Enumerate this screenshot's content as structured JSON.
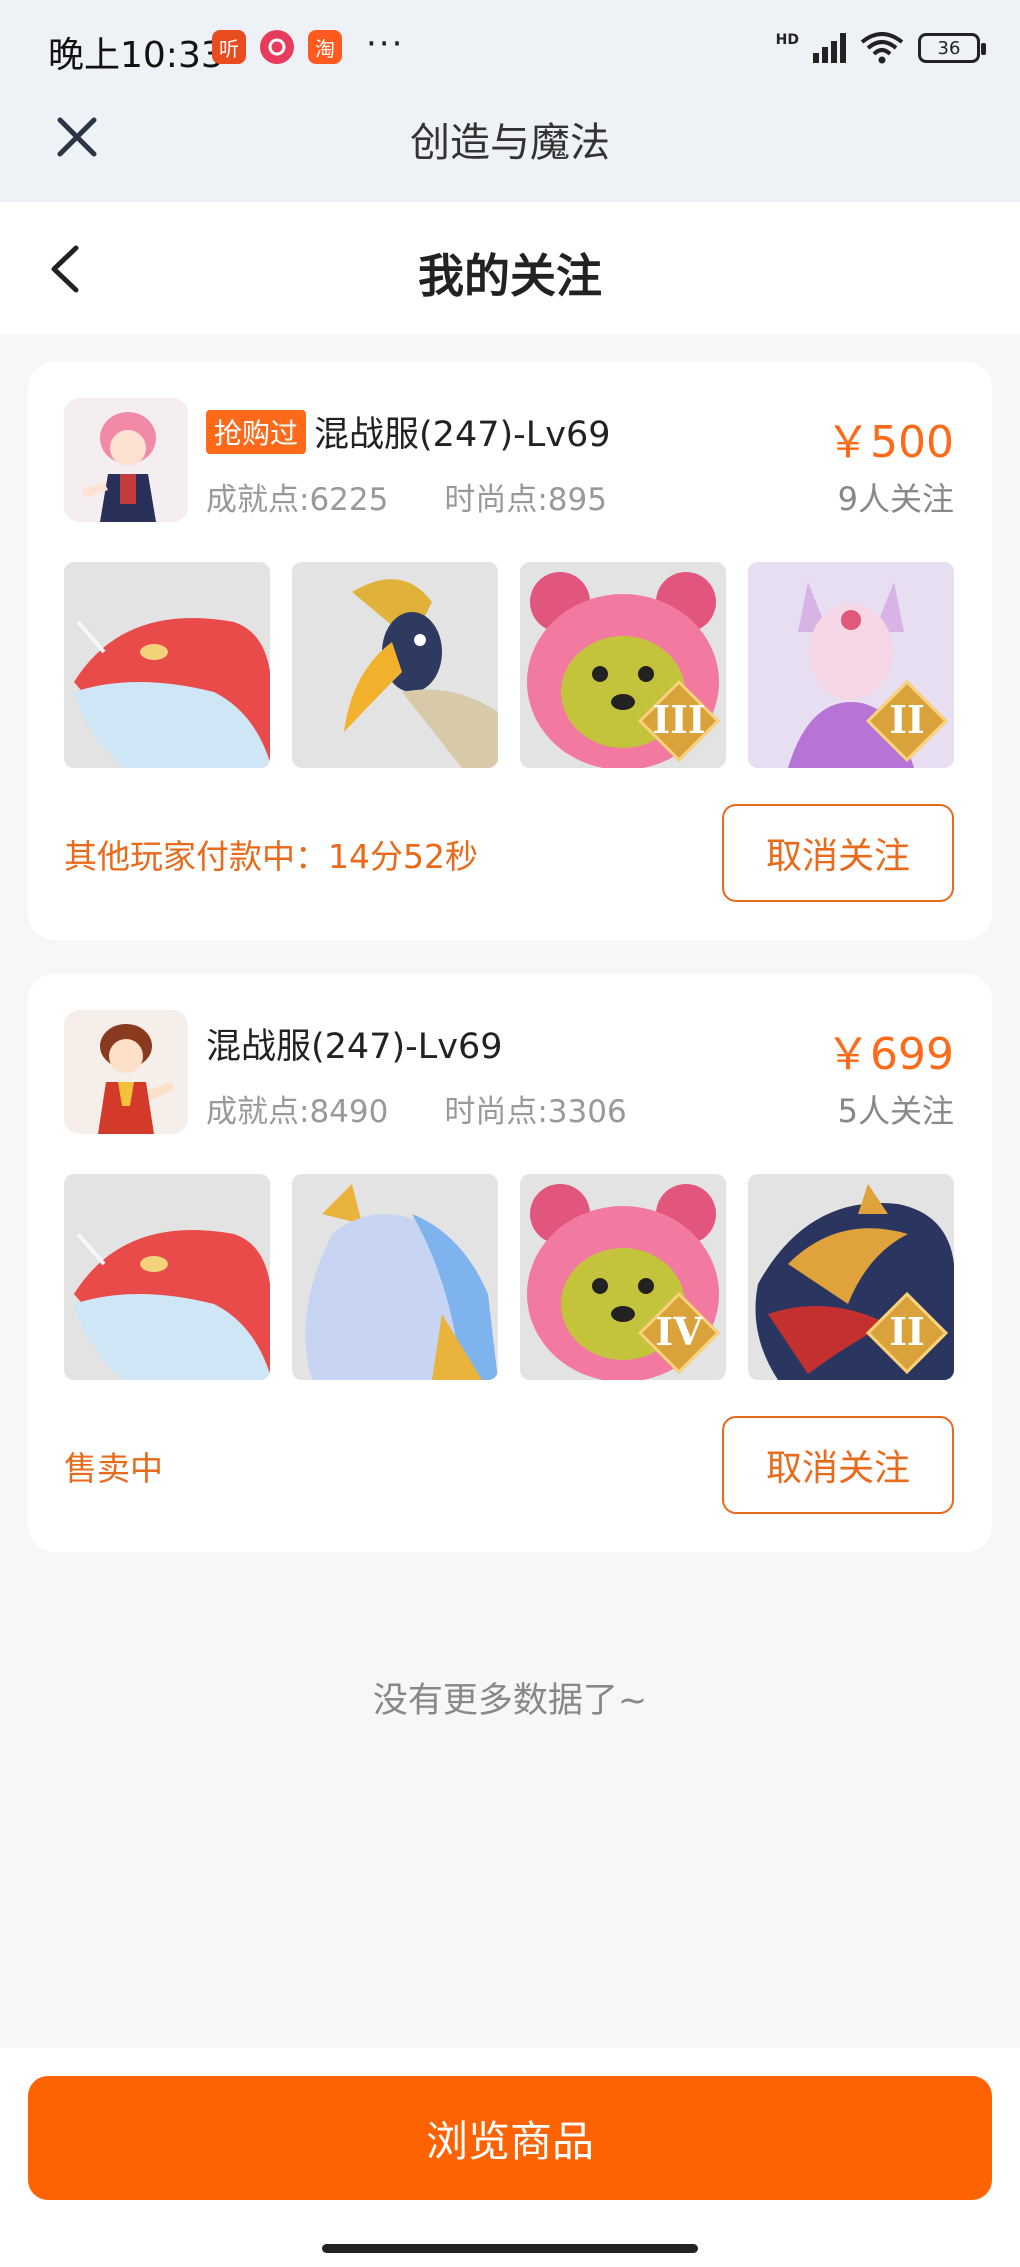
{
  "status_bar": {
    "time": "晚上10:33",
    "icons": [
      "ting-app-icon",
      "netease-music-icon",
      "taobao-icon"
    ],
    "app_ting": "听",
    "app_taobao": "淘",
    "more": "···",
    "network": "HD",
    "battery": "36"
  },
  "mini_header": {
    "title": "创造与魔法",
    "close_icon": "close-icon"
  },
  "page": {
    "title": "我的关注",
    "back_icon": "chevron-left-icon"
  },
  "listings": [
    {
      "badge": "抢购过",
      "title": "混战服(247)-Lv69",
      "achievement": "成就点:6225",
      "fashion": "时尚点:895",
      "price": "￥500",
      "followers": "9人关注",
      "thumbnails": [
        {
          "name": "dragon-fish-mount",
          "level": ""
        },
        {
          "name": "hornbill-mount",
          "level": ""
        },
        {
          "name": "pink-bear-pet",
          "level": "III"
        },
        {
          "name": "fox-spirit-pet",
          "level": "II"
        }
      ],
      "status": "其他玩家付款中：14分52秒",
      "action": "取消关注"
    },
    {
      "badge": "",
      "title": "混战服(247)-Lv69",
      "achievement": "成就点:8490",
      "fashion": "时尚点:3306",
      "price": "￥699",
      "followers": "5人关注",
      "thumbnails": [
        {
          "name": "dragon-fish-mount",
          "level": ""
        },
        {
          "name": "ice-horse-mount",
          "level": ""
        },
        {
          "name": "pink-bear-pet",
          "level": "IV"
        },
        {
          "name": "fire-dragon-mount",
          "level": "II"
        }
      ],
      "status": "售卖中",
      "action": "取消关注"
    }
  ],
  "footer": {
    "no_more": "没有更多数据了~",
    "browse_button": "浏览商品"
  },
  "colors": {
    "accent": "#ff6200",
    "status": "#e86a1a"
  }
}
